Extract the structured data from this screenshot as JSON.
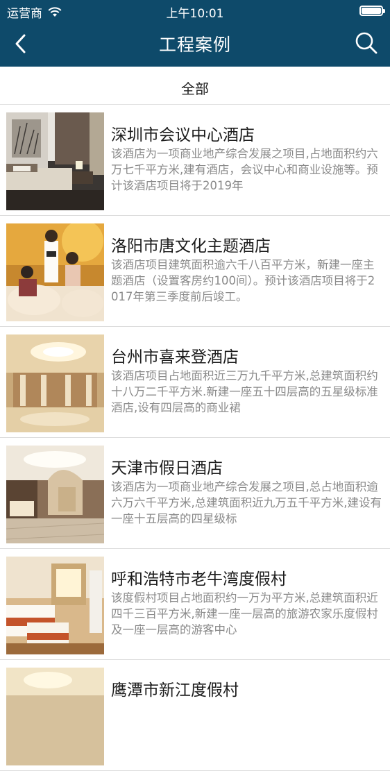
{
  "status": {
    "carrier": "运营商",
    "time": "上午10:01"
  },
  "nav": {
    "title": "工程案例"
  },
  "filter": {
    "label": "全部"
  },
  "items": [
    {
      "title": "深圳市会议中心酒店",
      "desc": "该酒店为一项商业地产综合发展之项目,占地面积约六万七千平方米,建有酒店，会议中心和商业设施等。预计该酒店项目将于2019年"
    },
    {
      "title": "洛阳市唐文化主题酒店",
      "desc": "该酒店项目建筑面积逾六千八百平方米，新建一座主题酒店（设置客房约100间）。预计该酒店项目将于2017年第三季度前后竣工。"
    },
    {
      "title": "台州市喜来登酒店",
      "desc": "该酒店项目占地面积近三万九千平方米,总建筑面积约十八万二千平方米.新建一座五十四层高的五星级标准酒店,设有四层高的商业裙"
    },
    {
      "title": "天津市假日酒店",
      "desc": "该酒店为一项商业地产综合发展之项目,总占地面积逾六万六千平方米,总建筑面积近九万五千平方米,建设有一座十五层高的四星级标"
    },
    {
      "title": "呼和浩特市老牛湾度假村",
      "desc": "该度假村项目占地面积约一万为平方米,总建筑面积近四千三百平方米,新建一座一层高的旅游农家乐度假村及一座一层高的游客中心"
    },
    {
      "title": "鹰潭市新江度假村",
      "desc": ""
    }
  ]
}
